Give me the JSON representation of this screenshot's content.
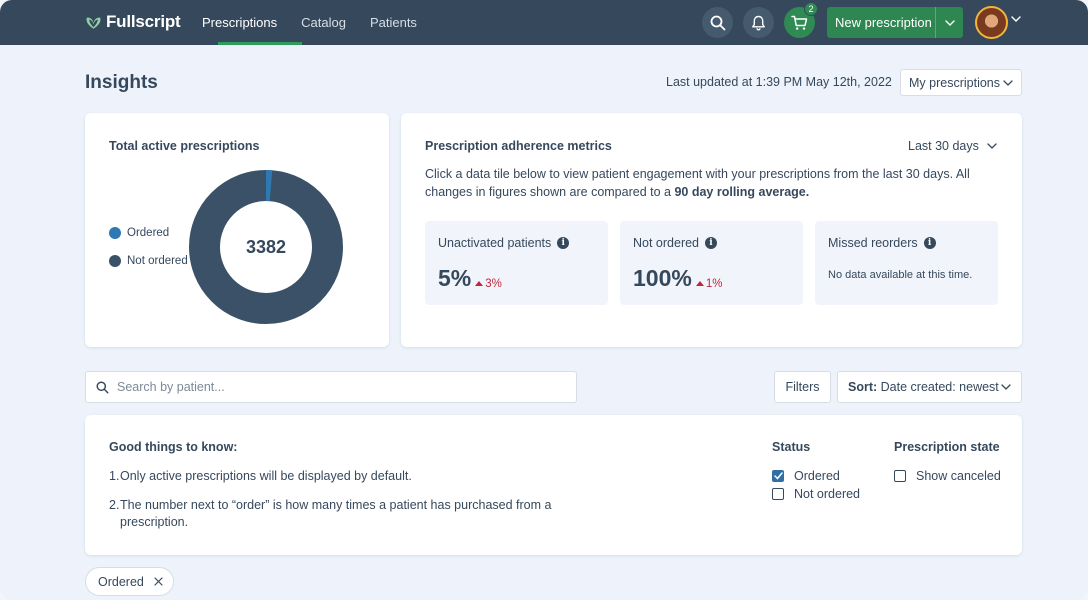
{
  "app": {
    "logo_text": "Fullscript"
  },
  "nav": {
    "items": [
      {
        "label": "Prescriptions",
        "active": true
      },
      {
        "label": "Catalog",
        "active": false
      },
      {
        "label": "Patients",
        "active": false
      }
    ]
  },
  "header_actions": {
    "cart_count": "2",
    "new_prescription_label": "New prescription"
  },
  "page": {
    "title": "Insights",
    "last_updated": "Last updated at 1:39 PM May 12th, 2022",
    "scope_select": "My prescriptions"
  },
  "total_card": {
    "title": "Total active prescriptions",
    "total": "3382",
    "legend": [
      {
        "label": "Ordered",
        "color": "#2f78b4"
      },
      {
        "label": "Not ordered",
        "color": "#3a5168"
      }
    ],
    "ordered_fraction": 0.013
  },
  "adherence_card": {
    "title": "Prescription adherence metrics",
    "period_select": "Last 30 days",
    "description_prefix": "Click a data tile below to view patient engagement with your prescriptions from the last 30 days. All changes in figures shown are compared to a ",
    "description_bold": "90 day rolling average.",
    "tiles": [
      {
        "label": "Unactivated patients",
        "value": "5%",
        "delta": "3%"
      },
      {
        "label": "Not ordered",
        "value": "100%",
        "delta": "1%"
      },
      {
        "label": "Missed reorders",
        "no_data": "No data available at this time."
      }
    ]
  },
  "search": {
    "placeholder": "Search by patient..."
  },
  "toolbar": {
    "filters_label": "Filters",
    "sort_prefix": "Sort:",
    "sort_value": "Date created: newest"
  },
  "info_panel": {
    "title": "Good things to know:",
    "items": [
      {
        "num": "1.",
        "text": "Only active prescriptions will be displayed by default."
      },
      {
        "num": "2.",
        "text": "The number next to “order” is how many times a patient has purchased from a prescription."
      }
    ],
    "status": {
      "heading": "Status",
      "options": [
        {
          "label": "Ordered",
          "checked": true
        },
        {
          "label": "Not ordered",
          "checked": false
        }
      ]
    },
    "state": {
      "heading": "Prescription state",
      "options": [
        {
          "label": "Show canceled",
          "checked": false
        }
      ]
    }
  },
  "active_chip": {
    "label": "Ordered"
  },
  "colors": {
    "nav_bg": "#36485c",
    "brand_green": "#2e8651",
    "accent_blue": "#2f78b4",
    "delta_red": "#c0263a"
  }
}
